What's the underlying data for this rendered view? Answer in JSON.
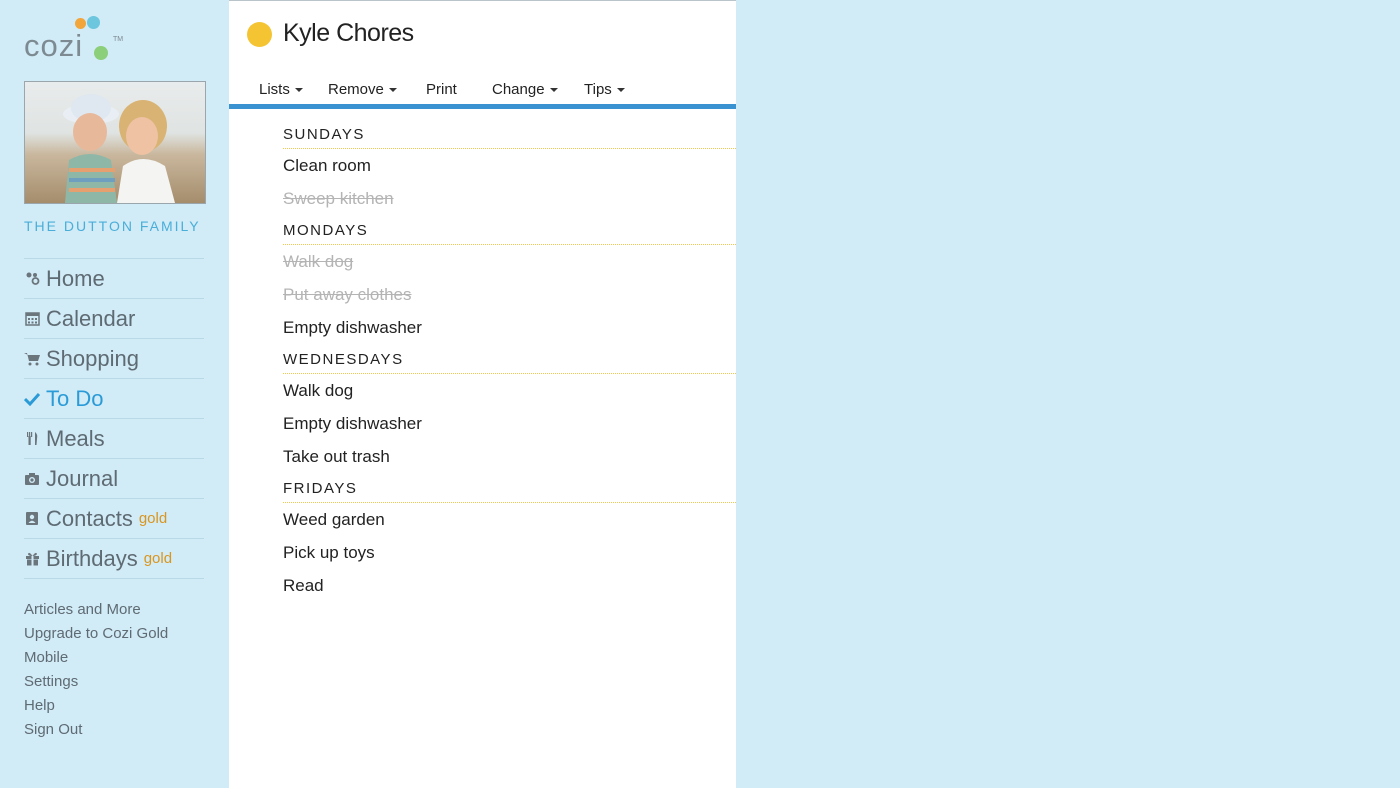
{
  "brand": {
    "logo_text": "cozi",
    "tm": "TM"
  },
  "sidebar": {
    "family_name": "THE DUTTON FAMILY",
    "nav": [
      {
        "label": "Home",
        "icon": "home-icon"
      },
      {
        "label": "Calendar",
        "icon": "calendar-icon"
      },
      {
        "label": "Shopping",
        "icon": "cart-icon"
      },
      {
        "label": "To Do",
        "icon": "checkmark-icon",
        "active": true
      },
      {
        "label": "Meals",
        "icon": "utensils-icon"
      },
      {
        "label": "Journal",
        "icon": "camera-icon"
      },
      {
        "label": "Contacts",
        "icon": "contacts-book-icon",
        "badge": "gold"
      },
      {
        "label": "Birthdays",
        "icon": "gift-icon",
        "badge": "gold"
      }
    ],
    "links": [
      "Articles and More",
      "Upgrade to Cozi Gold",
      "Mobile",
      "Settings",
      "Help",
      "Sign Out"
    ]
  },
  "main": {
    "title": "Kyle Chores",
    "title_dot_color": "#f4c433",
    "toolbar": {
      "lists": "Lists",
      "remove": "Remove",
      "print": "Print",
      "change": "Change",
      "tips": "Tips"
    },
    "sections": [
      {
        "name": "SUNDAYS",
        "items": [
          {
            "text": "Clean room",
            "done": false
          },
          {
            "text": "Sweep kitchen",
            "done": true
          }
        ]
      },
      {
        "name": "MONDAYS",
        "items": [
          {
            "text": "Walk dog",
            "done": true
          },
          {
            "text": "Put away clothes",
            "done": true
          },
          {
            "text": "Empty dishwasher",
            "done": false
          }
        ]
      },
      {
        "name": "WEDNESDAYS",
        "items": [
          {
            "text": "Walk dog",
            "done": false
          },
          {
            "text": "Empty dishwasher",
            "done": false
          },
          {
            "text": "Take out trash",
            "done": false
          }
        ]
      },
      {
        "name": "FRIDAYS",
        "items": [
          {
            "text": "Weed garden",
            "done": false
          },
          {
            "text": "Pick up toys",
            "done": false
          },
          {
            "text": "Read",
            "done": false
          }
        ]
      }
    ]
  },
  "colors": {
    "sidebar_bg": "#d1ebf7",
    "accent_blue": "#3a92d1",
    "active_nav": "#2b9bd8",
    "gold_badge": "#d9961f"
  }
}
